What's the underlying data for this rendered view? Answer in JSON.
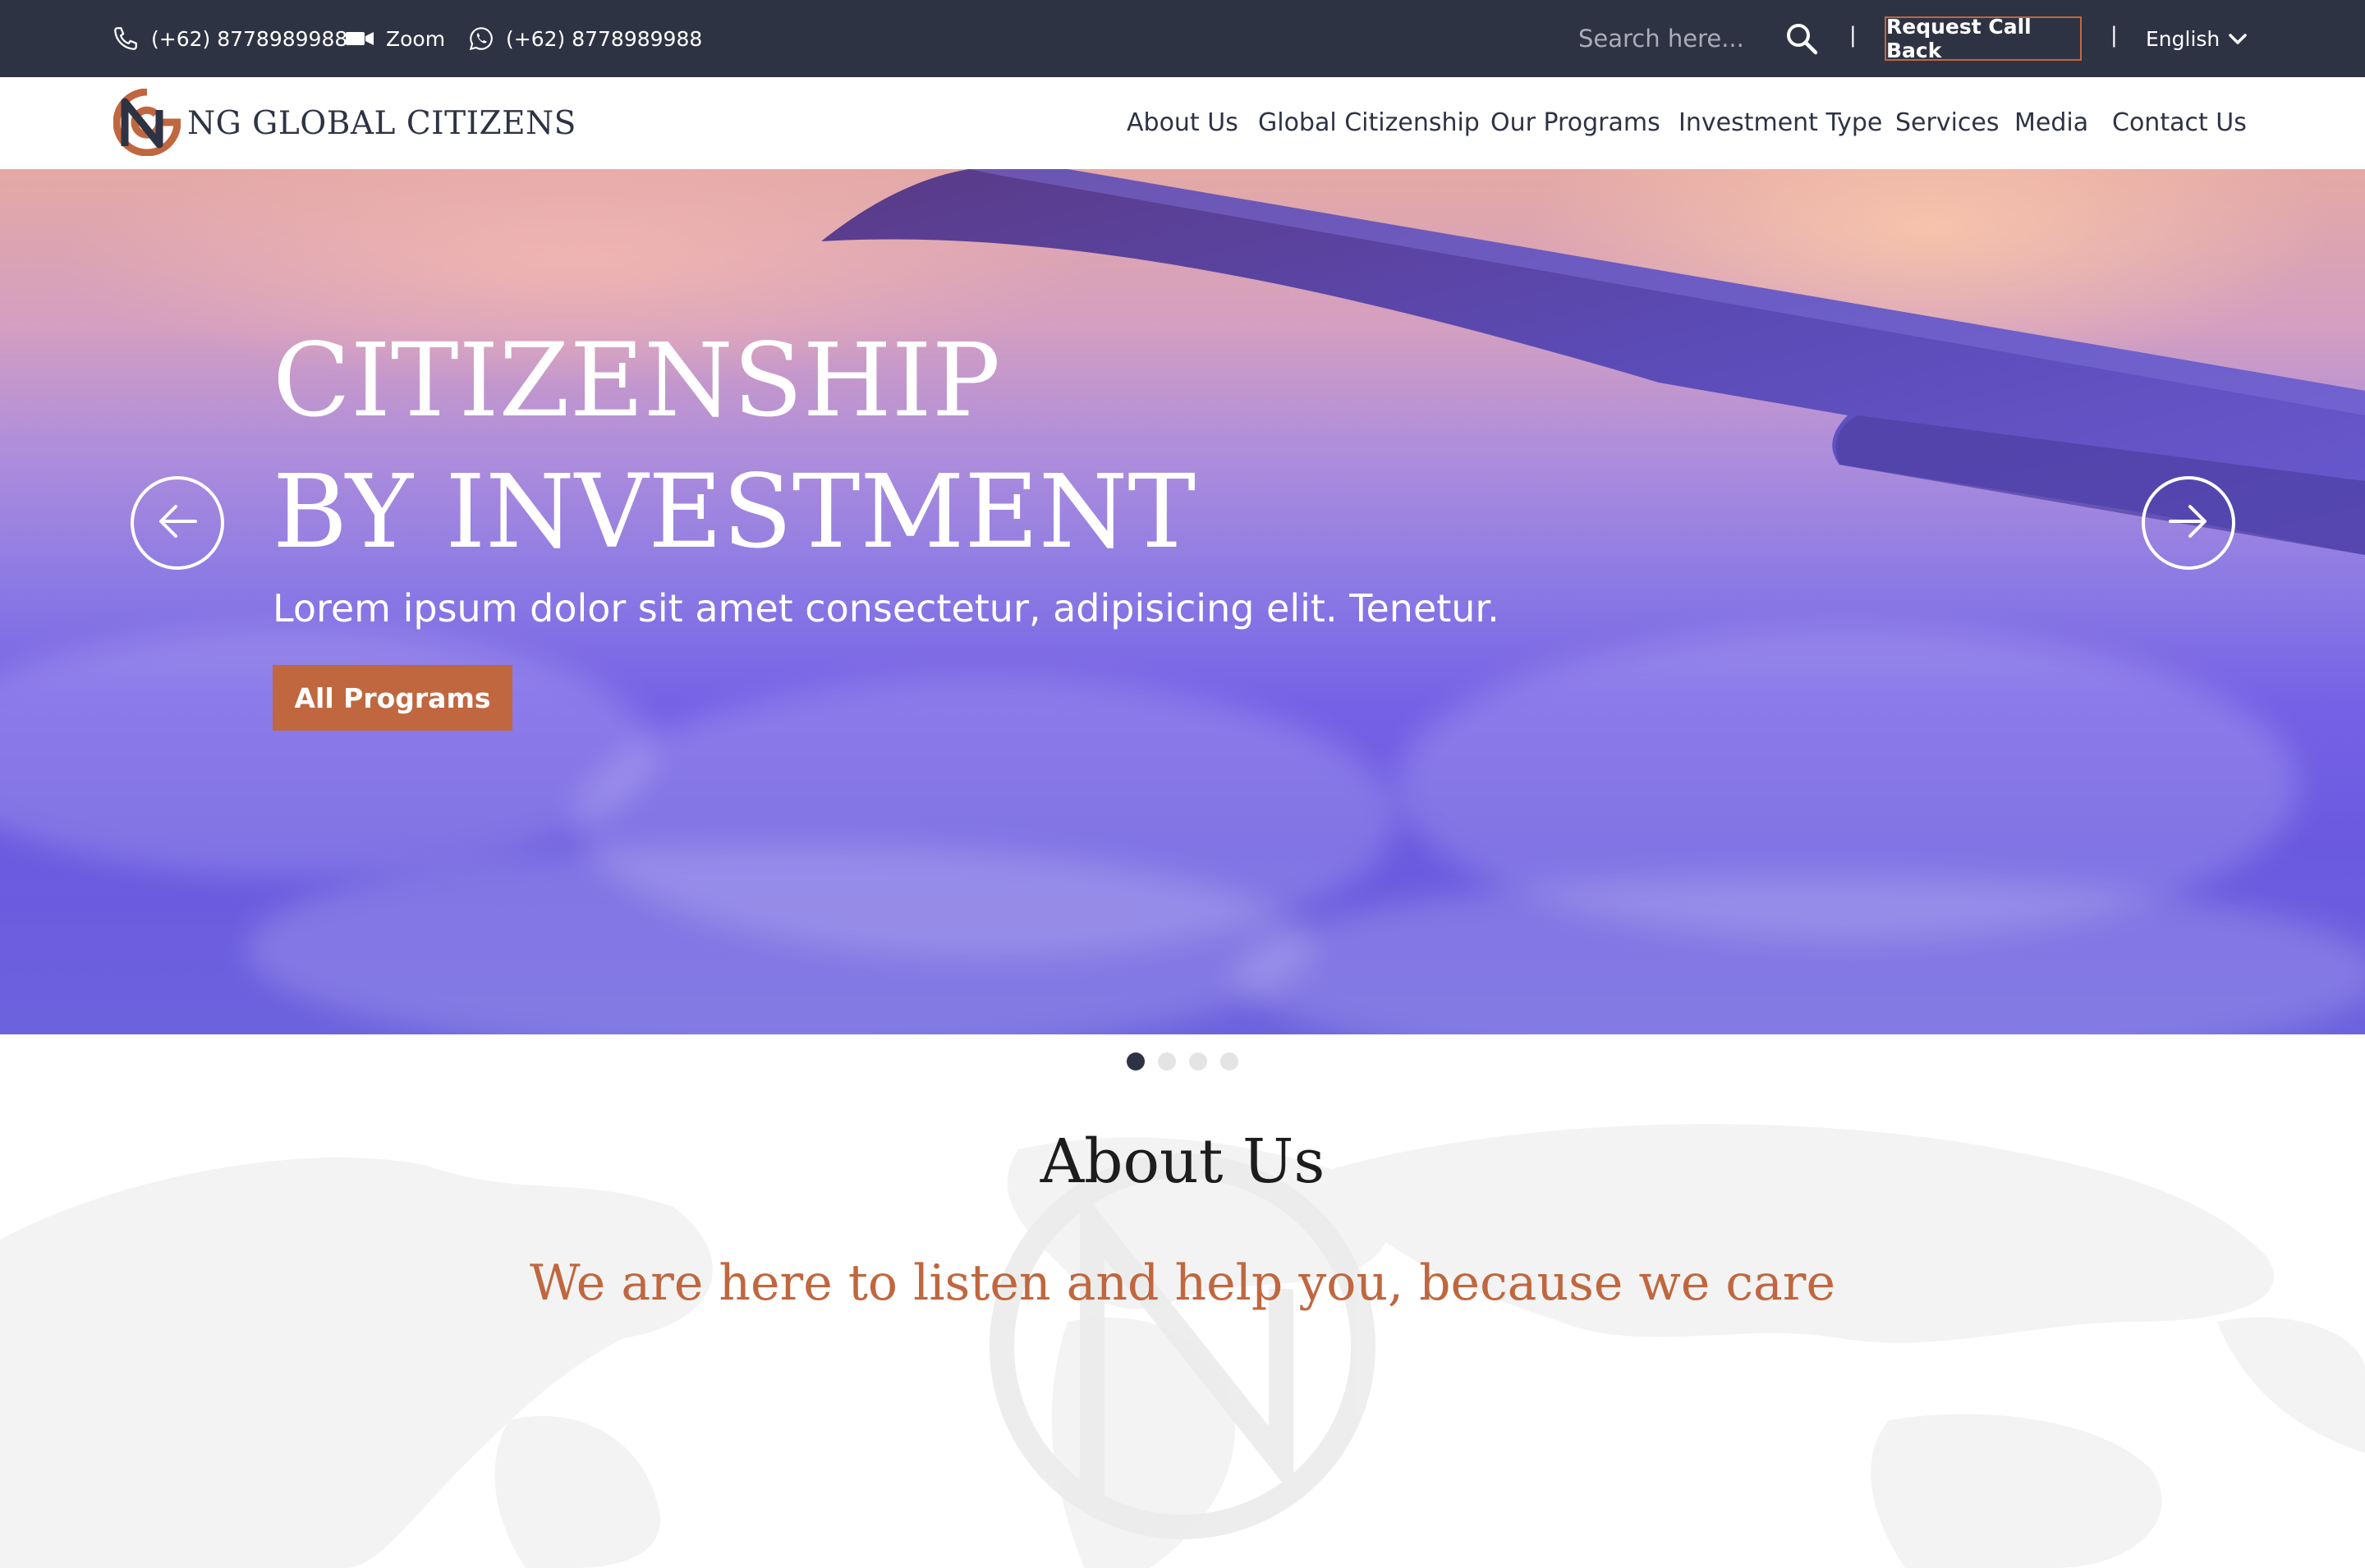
{
  "topbar": {
    "phone": "(+62) 8778989988",
    "zoom": "Zoom",
    "whatsapp": "(+62) 8778989988",
    "search_placeholder": "Search here...",
    "separator": "|",
    "request_call_back": "Request Call Back",
    "language": "English"
  },
  "brand": {
    "name": "NG GLOBAL CITIZENS"
  },
  "nav": {
    "items": [
      "About Us",
      "Global Citizenship",
      "Our Programs",
      "Investment Type",
      "Services",
      "Media",
      "Contact Us"
    ]
  },
  "hero": {
    "title_line1": "CITIZENSHIP",
    "title_line2": "BY INVESTMENT",
    "subtitle": "Lorem ipsum dolor sit amet consectetur, adipisicing elit. Tenetur.",
    "button": "All Programs",
    "active_slide": 1,
    "slide_count": 4
  },
  "about": {
    "title": "About Us",
    "tagline": "We are here to listen and help you, because we care"
  },
  "colors": {
    "topbar_bg": "#2e3344",
    "accent": "#c0673f",
    "text_dark": "#2e3344"
  }
}
